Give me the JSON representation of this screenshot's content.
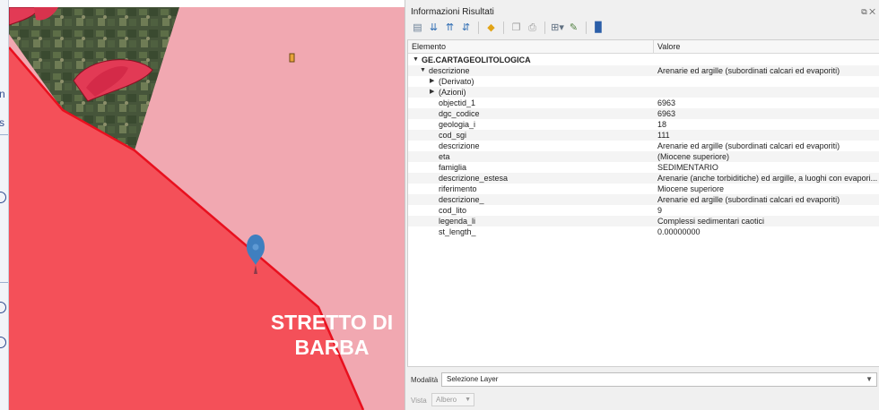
{
  "left_strip": {
    "fragment_1": "n",
    "fragment_2": "s"
  },
  "map": {
    "label_line_1": "STRETTO DI",
    "label_line_2": "BARBA",
    "colors": {
      "polygon_red": "#f45059",
      "polygon_pink": "#f1a8b1",
      "boundary": "#e8101e",
      "marker": "#3f7fbf",
      "small_feature": "#e8a33b"
    }
  },
  "panel": {
    "title": "Informazioni Risultati",
    "window_controls": "⧉ ✕",
    "toolbar_icons": [
      "expand-icon",
      "collapse-tree-icon",
      "expand-new-icon",
      "deselect-icon",
      "copy-feature-icon",
      "print-icon",
      "zoom-icon",
      "settings-icon",
      "help-icon"
    ],
    "columns": {
      "feature": "Elemento",
      "value": "Valore"
    },
    "tree": {
      "layer": "GE.CARTAGEOLITOLOGICA",
      "feature_key": "descrizione",
      "feature_value": "Arenarie ed argille (subordinati calcari ed evaporiti)",
      "derived": "(Derivato)",
      "actions": "(Azioni)",
      "attributes": [
        {
          "key": "objectid_1",
          "value": "6963"
        },
        {
          "key": "dgc_codice",
          "value": "6963"
        },
        {
          "key": "geologia_i",
          "value": "18"
        },
        {
          "key": "cod_sgi",
          "value": "111"
        },
        {
          "key": "descrizione",
          "value": "Arenarie ed argille (subordinati calcari ed evaporiti)"
        },
        {
          "key": "eta",
          "value": "(Miocene superiore)"
        },
        {
          "key": "famiglia",
          "value": "SEDIMENTARIO"
        },
        {
          "key": "descrizione_estesa",
          "value": "Arenarie (anche torbiditiche) ed argille, a luoghi con evapori..."
        },
        {
          "key": "riferimento",
          "value": "Miocene superiore"
        },
        {
          "key": "descrizione_",
          "value": "Arenarie ed argille (subordinati calcari ed evaporiti)"
        },
        {
          "key": "cod_lito",
          "value": "9"
        },
        {
          "key": "legenda_li",
          "value": "Complessi sedimentari caotici"
        },
        {
          "key": "st_length_",
          "value": "0.00000000"
        }
      ]
    },
    "mode_label": "Modalità",
    "mode_value": "Selezione Layer",
    "view_label": "Vista",
    "view_value": "Albero"
  }
}
